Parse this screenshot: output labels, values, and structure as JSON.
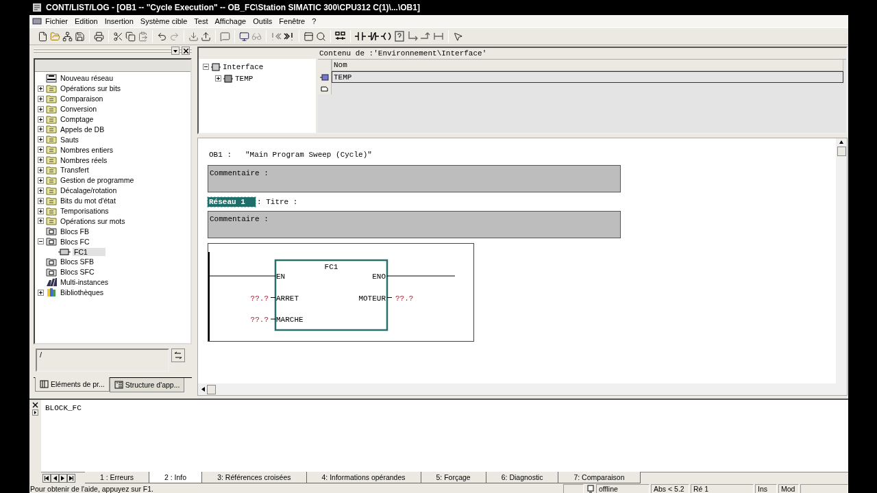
{
  "window": {
    "title": "CONT/LIST/LOG - [OB1 -- \"Cycle Execution\" -- OB_FC\\Station SIMATIC 300\\CPU312 C(1)\\...\\OB1]"
  },
  "menu": [
    "Fichier",
    "Edition",
    "Insertion",
    "Système cible",
    "Test",
    "Affichage",
    "Outils",
    "Fenêtre",
    "?"
  ],
  "catalog": {
    "items": [
      {
        "label": "Nouveau réseau",
        "kind": "network",
        "selected": false
      },
      {
        "label": "Opérations sur bits",
        "kind": "folder",
        "expanded": false,
        "selected": false
      },
      {
        "label": "Comparaison",
        "kind": "folder",
        "expanded": false,
        "selected": false
      },
      {
        "label": "Conversion",
        "kind": "folder",
        "expanded": false,
        "selected": false
      },
      {
        "label": "Comptage",
        "kind": "folder",
        "expanded": false,
        "selected": false
      },
      {
        "label": "Appels de DB",
        "kind": "folder",
        "expanded": false,
        "selected": false
      },
      {
        "label": "Sauts",
        "kind": "folder",
        "expanded": false,
        "selected": false
      },
      {
        "label": "Nombres entiers",
        "kind": "folder",
        "expanded": false,
        "selected": false
      },
      {
        "label": "Nombres réels",
        "kind": "folder",
        "expanded": false,
        "selected": false
      },
      {
        "label": "Transfert",
        "kind": "folder",
        "expanded": false,
        "selected": false
      },
      {
        "label": "Gestion de programme",
        "kind": "folder",
        "expanded": false,
        "selected": false
      },
      {
        "label": "Décalage/rotation",
        "kind": "folder",
        "expanded": false,
        "selected": false
      },
      {
        "label": "Bits du mot d'état",
        "kind": "folder",
        "expanded": false,
        "selected": false
      },
      {
        "label": "Temporisations",
        "kind": "folder",
        "expanded": false,
        "selected": false
      },
      {
        "label": "Opérations sur mots",
        "kind": "folder",
        "expanded": false,
        "selected": false
      },
      {
        "label": "Blocs FB",
        "kind": "blocks",
        "selected": false
      },
      {
        "label": "Blocs FC",
        "kind": "blocks",
        "expanded": true,
        "selected": false,
        "children": [
          {
            "label": "FC1",
            "kind": "block",
            "selected": true
          }
        ]
      },
      {
        "label": "Blocs SFB",
        "kind": "blocks",
        "selected": false
      },
      {
        "label": "Blocs SFC",
        "kind": "blocks",
        "selected": false
      },
      {
        "label": "Multi-instances",
        "kind": "multi",
        "selected": false
      },
      {
        "label": "Bibliothèques",
        "kind": "library",
        "expanded": false,
        "selected": false
      }
    ],
    "field": {
      "value": "/"
    },
    "tabs": [
      {
        "label": "Eléments de pr...",
        "selected": true
      },
      {
        "label": "Structure d'app...",
        "selected": false
      }
    ]
  },
  "interface": {
    "tree": [
      {
        "label": "Interface",
        "expanded": true,
        "children": [
          {
            "label": "TEMP",
            "expanded": false
          }
        ]
      }
    ],
    "content_title": "Contenu de :'Environnement\\Interface'",
    "column": "Nom",
    "rows": [
      {
        "name": "TEMP",
        "selected": true
      }
    ]
  },
  "editor": {
    "block_name": "OB1 :",
    "block_title": "\"Main Program Sweep (Cycle)\"",
    "block_comment": "Commentaire :",
    "network": {
      "label": "Réseau 1",
      "selected": true,
      "title": ": Titre :",
      "comment": "Commentaire :",
      "box": {
        "name": "FC1",
        "inputs": [
          {
            "pin": "EN"
          },
          {
            "pin": "ARRET",
            "operand": "??.?"
          },
          {
            "pin": "MARCHE",
            "operand": "??.?"
          }
        ],
        "outputs": [
          {
            "pin": "ENO"
          },
          {
            "pin": "MOTEUR",
            "operand": "??.?"
          }
        ]
      }
    }
  },
  "output": {
    "text": "BLOCK_FC",
    "tabs": [
      {
        "label": "1 : Erreurs",
        "selected": false
      },
      {
        "label": "2 : Info",
        "selected": true
      },
      {
        "label": "3: Références croisées",
        "selected": false
      },
      {
        "label": "4: Informations opérandes",
        "selected": false
      },
      {
        "label": "5: Forçage",
        "selected": false
      },
      {
        "label": "6: Diagnostic",
        "selected": false
      },
      {
        "label": "7: Comparaison",
        "selected": false
      }
    ]
  },
  "status_bar": {
    "help": "Pour obtenir de l'aide, appuyez sur F1.",
    "mode": "offline",
    "version": "Abs < 5.2",
    "network": "Ré 1",
    "insert": "Ins",
    "modified": "Mod"
  }
}
